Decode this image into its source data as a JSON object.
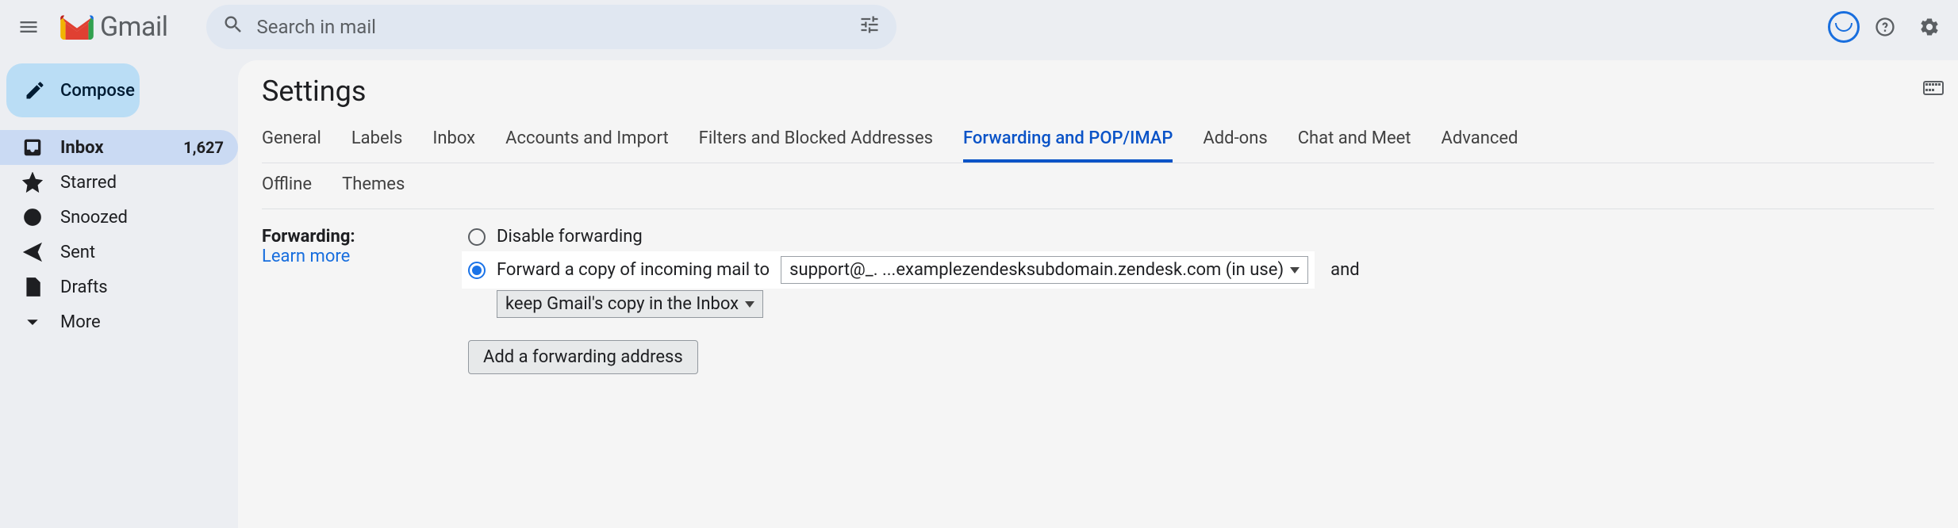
{
  "header": {
    "app_name": "Gmail",
    "search_placeholder": "Search in mail"
  },
  "compose_label": "Compose",
  "sidebar": {
    "items": [
      {
        "label": "Inbox",
        "count": "1,627",
        "active": true
      },
      {
        "label": "Starred"
      },
      {
        "label": "Snoozed"
      },
      {
        "label": "Sent"
      },
      {
        "label": "Drafts"
      },
      {
        "label": "More"
      }
    ]
  },
  "page": {
    "title": "Settings",
    "tabs_row1": [
      "General",
      "Labels",
      "Inbox",
      "Accounts and Import",
      "Filters and Blocked Addresses",
      "Forwarding and POP/IMAP",
      "Add-ons",
      "Chat and Meet",
      "Advanced"
    ],
    "tabs_row2": [
      "Offline",
      "Themes"
    ],
    "active_tab": "Forwarding and POP/IMAP"
  },
  "forwarding": {
    "section_title": "Forwarding:",
    "learn_more": "Learn more",
    "radio_disable": "Disable forwarding",
    "radio_forward_prefix": "Forward a copy of incoming mail to",
    "address_selected": "support@_. ...examplezendesksubdomain.zendesk.com (in use)",
    "and": "and",
    "keep_option": "keep Gmail's copy in the Inbox",
    "add_button": "Add a forwarding address"
  }
}
